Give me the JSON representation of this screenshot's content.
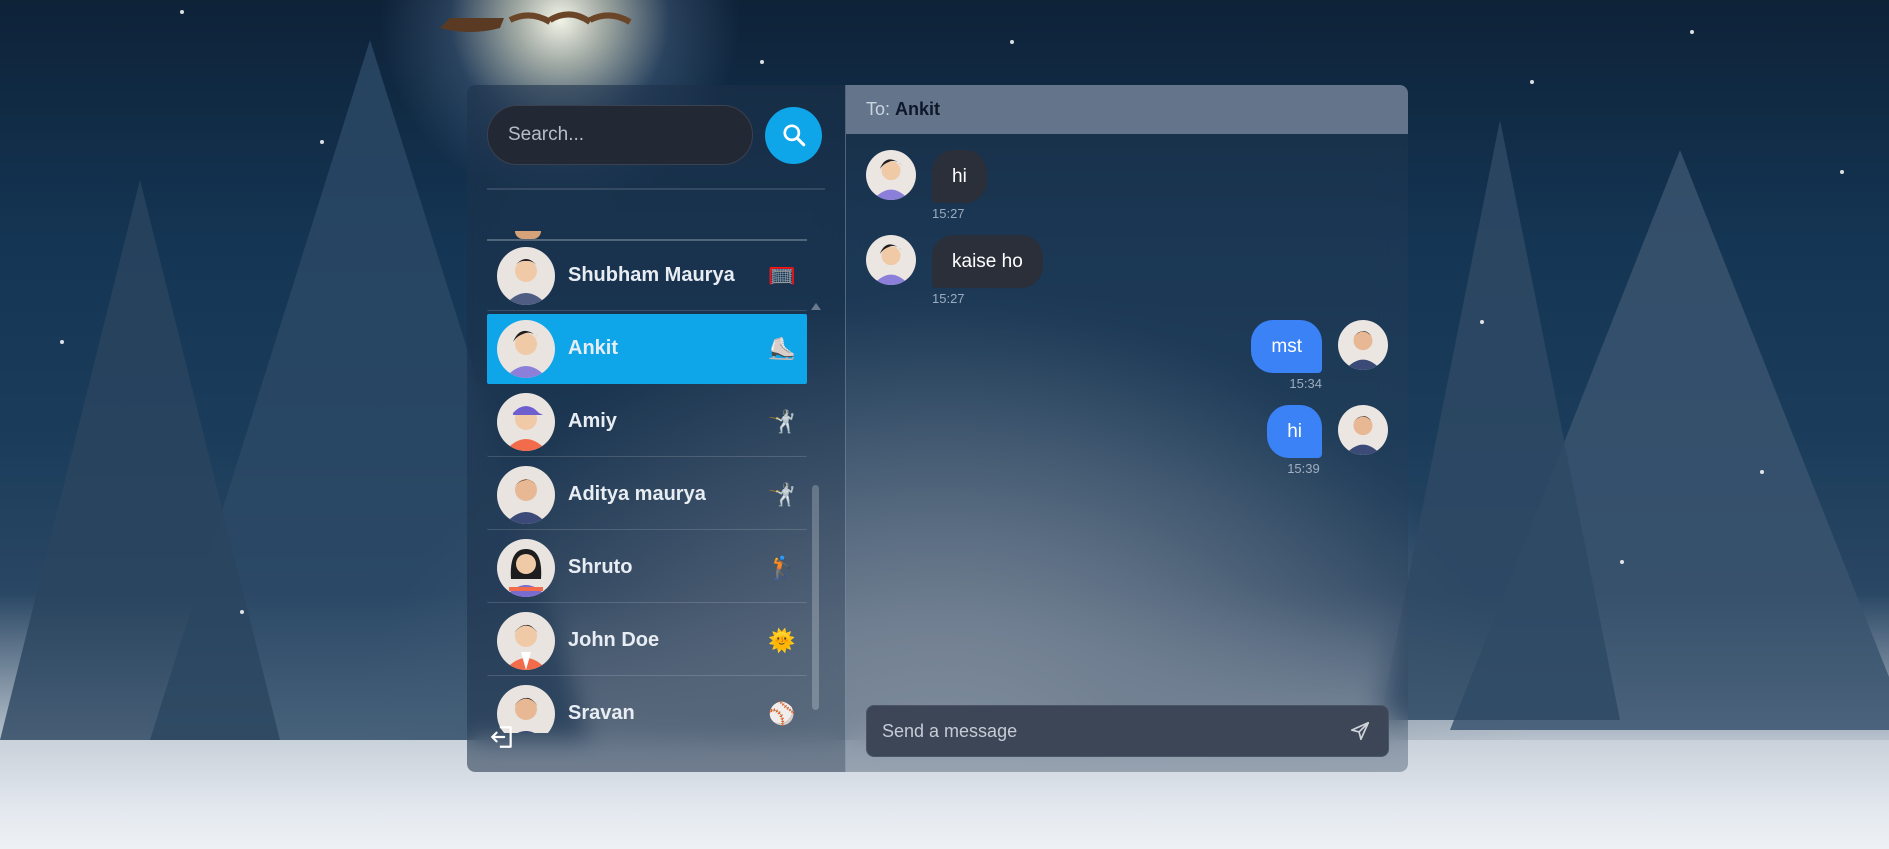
{
  "search": {
    "placeholder": "Search..."
  },
  "contacts": [
    {
      "name": "Shubham Maurya",
      "emoji": "🥅",
      "active": false
    },
    {
      "name": "Ankit",
      "emoji": "⛸️",
      "active": true
    },
    {
      "name": "Amiy",
      "emoji": "🤺",
      "active": false
    },
    {
      "name": "Aditya maurya",
      "emoji": "🤺",
      "active": false
    },
    {
      "name": "Shruto",
      "emoji": "🏌️",
      "active": false
    },
    {
      "name": "John Doe",
      "emoji": "🌞",
      "active": false
    },
    {
      "name": "Sravan",
      "emoji": "⚾",
      "active": false
    }
  ],
  "chat": {
    "to_label": "To:",
    "to_name": "Ankit",
    "messages": [
      {
        "text": "hi",
        "time": "15:27",
        "direction": "in"
      },
      {
        "text": "kaise ho",
        "time": "15:27",
        "direction": "in"
      },
      {
        "text": "mst",
        "time": "15:34",
        "direction": "out"
      },
      {
        "text": "hi",
        "time": "15:39",
        "direction": "out"
      }
    ],
    "composer_placeholder": "Send a message"
  },
  "colors": {
    "accent": "#0ea5e9",
    "outgoing_bubble": "#3b82f6",
    "incoming_bubble": "#2a2f3a",
    "header": "#64748b"
  },
  "icons": {
    "search": "search-icon",
    "logout": "logout-icon",
    "send": "send-icon"
  }
}
